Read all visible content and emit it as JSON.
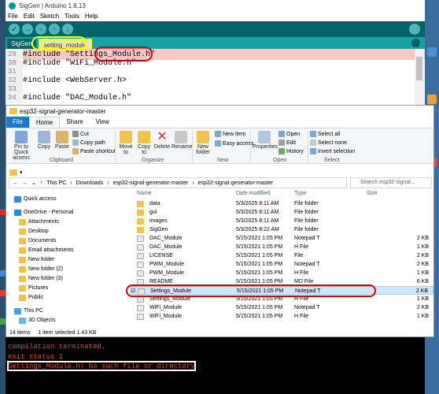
{
  "arduino": {
    "title": "SigGen | Arduino 1.8.13",
    "menu": [
      "File",
      "Edit",
      "Sketch",
      "Tools",
      "Help"
    ],
    "tabs": [
      "SigGen",
      "setting_module"
    ],
    "code": [
      {
        "n": "29",
        "text": "#include \"Settings_Module.h\""
      },
      {
        "n": "30",
        "text": "#include \"WiFi_Module.h\""
      },
      {
        "n": "31",
        "text": ""
      },
      {
        "n": "32",
        "text": "#include <WebServer.h>"
      },
      {
        "n": "33",
        "text": ""
      },
      {
        "n": "34",
        "text": "#include \"DAC_Module.h\""
      }
    ]
  },
  "explorer": {
    "title": "esp32-signal-generator-master",
    "ribbon_tabs": [
      "File",
      "Home",
      "Share",
      "View"
    ],
    "clipboard": {
      "pin": "Pin to Quick access",
      "copy": "Copy",
      "paste": "Paste",
      "cut": "Cut",
      "copy_path": "Copy path",
      "paste_shortcut": "Paste shortcut",
      "group": "Clipboard"
    },
    "organize": {
      "move": "Move to",
      "copy": "Copy to",
      "delete": "Delete",
      "rename": "Rename",
      "group": "Organize"
    },
    "new": {
      "folder": "New folder",
      "item": "New item",
      "easy": "Easy access",
      "group": "New"
    },
    "open": {
      "properties": "Properties",
      "open": "Open",
      "edit": "Edit",
      "history": "History",
      "group": "Open"
    },
    "select": {
      "all": "Select all",
      "none": "Select none",
      "invert": "Invert selection",
      "group": "Select"
    },
    "breadcrumb": [
      "This PC",
      "Downloads",
      "esp32-signal-generator-master",
      "esp32-signal-generator-master"
    ],
    "search_placeholder": "Search esp32-signal...",
    "nav": [
      "Quick access",
      "OneDrive - Personal",
      "Attachments",
      "Desktop",
      "Documents",
      "Email attachments",
      "New folder",
      "New folder (2)",
      "New folder (3)",
      "Pictures",
      "Public",
      "This PC",
      "3D Objects"
    ],
    "headers": [
      "Name",
      "Date modified",
      "Type",
      "Size"
    ],
    "files": [
      {
        "name": "data",
        "date": "5/3/2025 8:11 AM",
        "type": "File folder",
        "size": "",
        "kind": "folder"
      },
      {
        "name": "gui",
        "date": "5/3/2025 8:11 AM",
        "type": "File folder",
        "size": "",
        "kind": "folder"
      },
      {
        "name": "images",
        "date": "5/3/2025 8:11 AM",
        "type": "File folder",
        "size": "",
        "kind": "folder"
      },
      {
        "name": "SigGen",
        "date": "5/3/2025 8:22 AM",
        "type": "File folder",
        "size": "",
        "kind": "folder"
      },
      {
        "name": "DAC_Module",
        "date": "5/15/2021 1:05 PM",
        "type": "Notepad T",
        "size": "2 KB",
        "kind": "file"
      },
      {
        "name": "DAC_Module",
        "date": "5/15/2021 1:05 PM",
        "type": "H File",
        "size": "1 KB",
        "kind": "file"
      },
      {
        "name": "LICENSE",
        "date": "5/15/2021 1:05 PM",
        "type": "File",
        "size": "2 KB",
        "kind": "file"
      },
      {
        "name": "PWM_Module",
        "date": "5/15/2021 1:05 PM",
        "type": "Notepad T",
        "size": "2 KB",
        "kind": "file"
      },
      {
        "name": "PWM_Module",
        "date": "5/15/2021 1:05 PM",
        "type": "H File",
        "size": "1 KB",
        "kind": "file"
      },
      {
        "name": "README",
        "date": "5/15/2021 1:05 PM",
        "type": "MD File",
        "size": "6 KB",
        "kind": "file"
      },
      {
        "name": "Settings_Module",
        "date": "5/15/2021 1:05 PM",
        "type": "Notepad T",
        "size": "2 KB",
        "kind": "file"
      },
      {
        "name": "Settings_Module",
        "date": "5/15/2021 1:05 PM",
        "type": "H File",
        "size": "1 KB",
        "kind": "file"
      },
      {
        "name": "WiFi_Module",
        "date": "5/15/2021 1:05 PM",
        "type": "Notepad T",
        "size": "2 KB",
        "kind": "file"
      },
      {
        "name": "WiFi_Module",
        "date": "5/15/2021 1:05 PM",
        "type": "H File",
        "size": "1 KB",
        "kind": "file"
      }
    ],
    "status_items": "14 items",
    "status_selected": "1 item selected  1.43 KB"
  },
  "console": [
    "compilation terminated.",
    "exit status 1",
    "Settings_Module.h: No such file or directory"
  ],
  "colors": {
    "arduino_teal": "#006468",
    "explorer_blue": "#1979ca",
    "annotation_red": "#e00000",
    "console_text": "#e44c2a"
  }
}
